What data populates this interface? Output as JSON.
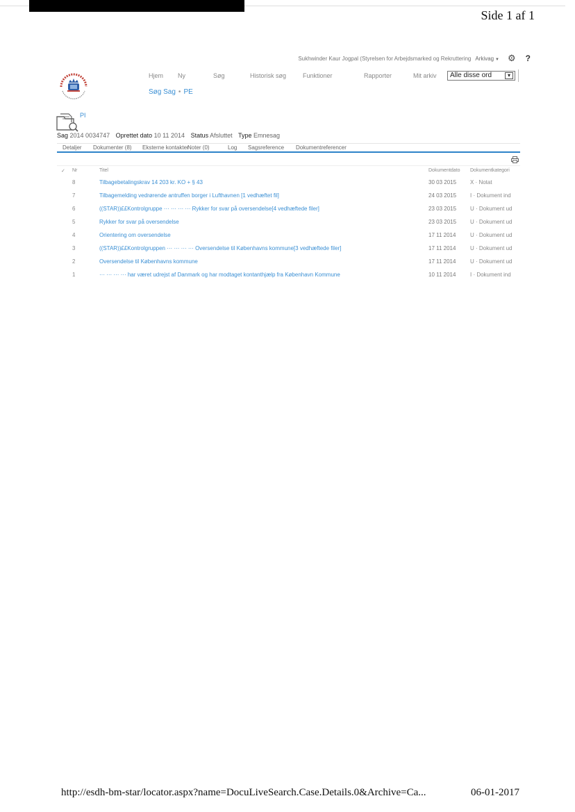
{
  "page": {
    "label": "Side 1 af 1"
  },
  "userbar": {
    "user": "Sukhwinder Kaur Jogpal (Styrelsen for Arbejdsmarked og Rekruttering",
    "archive": "Arkivag",
    "help": "?"
  },
  "nav": {
    "items": [
      "Hjem",
      "Ny",
      "Søg",
      "Historisk søg",
      "Funktioner",
      "Rapporter",
      "Mit arkiv"
    ]
  },
  "search": {
    "value": "Alle disse ord",
    "dropdown": "▾"
  },
  "breadcrumb": {
    "parent": "Søg Sag",
    "current": "PE"
  },
  "case": {
    "icon_label": "PI",
    "sag_key": "Sag",
    "sag_value": "2014 0034747",
    "created_key": "Oprettet dato",
    "created_value": "10 11 2014",
    "status_key": "Status",
    "status_value": "Afsluttet",
    "type_key": "Type",
    "type_value": "Emnesag"
  },
  "tabs": [
    "Detaljer",
    "Dokumenter (8)",
    "Eksterne kontakter",
    "Noter (0)",
    "Log",
    "Sagsreference",
    "Dokumentreferencer"
  ],
  "table": {
    "headers": {
      "check": "✓",
      "nr": "Nr",
      "title": "Titel",
      "date": "Dokumentdato",
      "category": "Dokumentkategori"
    },
    "rows": [
      {
        "nr": "8",
        "title": "Tilbagebetalingskrav 14 203 kr. KO + § 43",
        "date": "30 03 2015",
        "category": "X · Notat"
      },
      {
        "nr": "7",
        "title": "Tilbagemelding vedrørende antruffen borger i Lufthavnen [1 vedhæftet fil]",
        "date": "24 03 2015",
        "category": "I · Dokument ind"
      },
      {
        "nr": "6",
        "title": "((STAR))££Kontrolgruppe  ··· ··· ··· ··· Rykker for svar på oversendelse[4 vedhæftede filer]",
        "date": "23 03 2015",
        "category": "U · Dokument ud"
      },
      {
        "nr": "5",
        "title": "Rykker for svar på oversendelse",
        "date": "23 03 2015",
        "category": "U · Dokument ud"
      },
      {
        "nr": "4",
        "title": "Orientering om oversendelse",
        "date": "17 11 2014",
        "category": "U · Dokument ud"
      },
      {
        "nr": "3",
        "title": "((STAR))££Kontrolgruppen  ··· ··· ··· ··· Oversendelse til Københavns kommune[3 vedhæftede filer]",
        "date": "17 11 2014",
        "category": "U · Dokument ud"
      },
      {
        "nr": "2",
        "title": "Oversendelse til Københavns kommune",
        "date": "17 11 2014",
        "category": "U · Dokument ud"
      },
      {
        "nr": "1",
        "title": "··· ··· ··· ··· har været udrejst af Danmark og har modtaget kontanthjælp fra København Kommune",
        "date": "10 11 2014",
        "category": "I · Dokument ind"
      }
    ]
  },
  "footer": {
    "url": "http://esdh-bm-star/locator.aspx?name=DocuLiveSearch.Case.Details.0&Archive=Ca...",
    "date": "06-01-2017"
  }
}
